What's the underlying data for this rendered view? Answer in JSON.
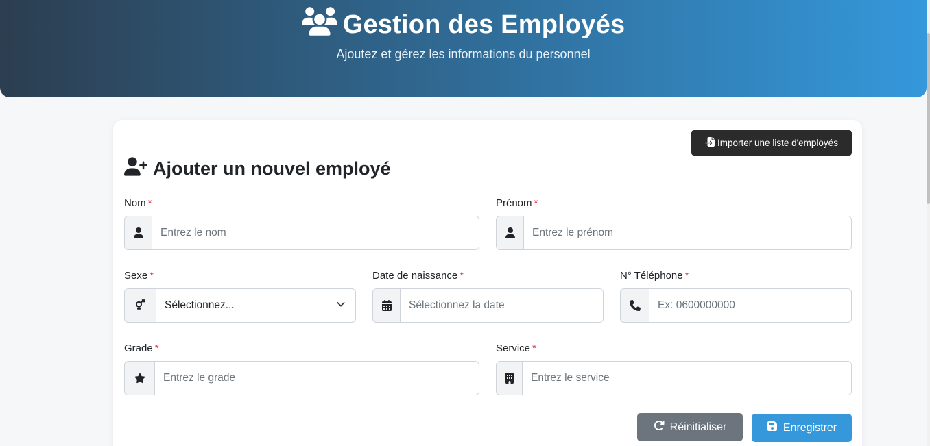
{
  "header": {
    "title": "Gestion des Employés",
    "subtitle": "Ajoutez et gérez les informations du personnel",
    "icon": "users-icon"
  },
  "form": {
    "import_button_label": "Importer une liste d'employés",
    "title": "Ajouter un nouvel employé",
    "required_marker": "*",
    "fields": {
      "nom": {
        "label": "Nom",
        "placeholder": "Entrez le nom",
        "icon": "user-icon"
      },
      "prenom": {
        "label": "Prénom",
        "placeholder": "Entrez le prénom",
        "icon": "user-icon"
      },
      "sexe": {
        "label": "Sexe",
        "value": "Sélectionnez...",
        "icon": "venus-mars-icon"
      },
      "date_naissance": {
        "label": "Date de naissance",
        "placeholder": "Sélectionnez la date",
        "icon": "calendar-icon"
      },
      "telephone": {
        "label": "N° Téléphone",
        "placeholder": "Ex: 0600000000",
        "icon": "phone-icon"
      },
      "grade": {
        "label": "Grade",
        "placeholder": "Entrez le grade",
        "icon": "star-icon"
      },
      "service": {
        "label": "Service",
        "placeholder": "Entrez le service",
        "icon": "building-icon"
      }
    },
    "reset_label": "Réinitialiser",
    "save_label": "Enregistrer"
  },
  "colors": {
    "header_gradient_start": "#2c3e50",
    "header_gradient_end": "#3498db",
    "required": "#dc3545",
    "save_button": "#3498db",
    "reset_button": "#6c757d",
    "import_button": "#2b2b2b"
  }
}
